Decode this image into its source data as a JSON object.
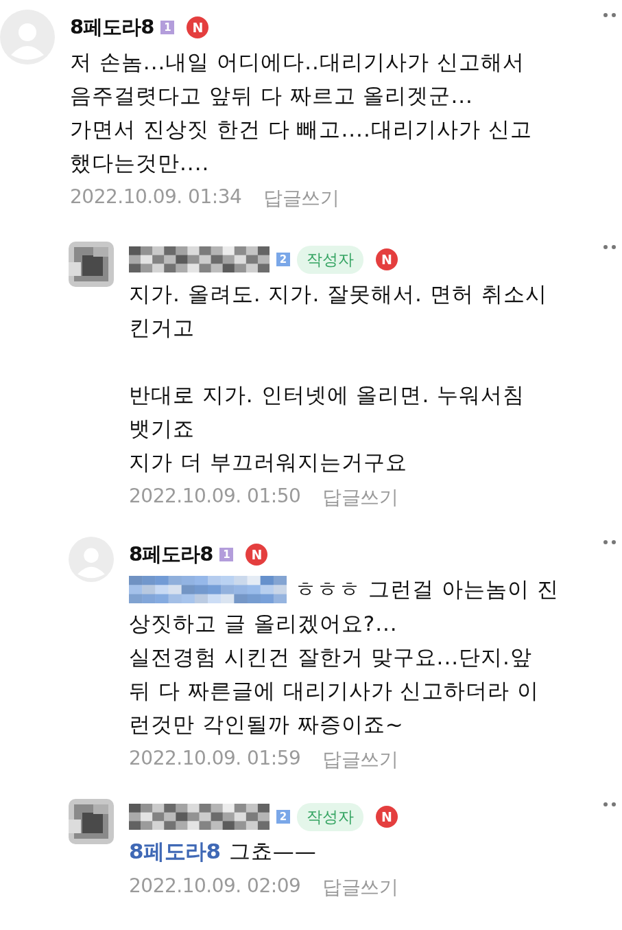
{
  "comments": [
    {
      "reply": false,
      "avatar": {
        "kind": "default"
      },
      "author": {
        "kind": "name",
        "text": "8페도라8"
      },
      "level": {
        "text": "1",
        "color": "#b39ddb"
      },
      "new_badge": "N",
      "paragraphs": [
        "저 손놈...내일 어디에다..대리기사가 신고해서\n음주걸렷다고 앞뒤 다 짜르고 올리겟군...\n가면서 진상짓 한건 다 빼고....대리기사가 신고\n했다는것만...."
      ],
      "date": "2022.10.09. 01:34",
      "reply_link": "답글쓰기"
    },
    {
      "reply": true,
      "avatar": {
        "kind": "blurred"
      },
      "author": {
        "kind": "blurred"
      },
      "level": {
        "text": "2",
        "color": "#7aa7e8"
      },
      "writer_badge": "작성자",
      "new_badge": "N",
      "paragraphs": [
        "지가. 올려도. 지가. 잘못해서. 면허 취소시\n킨거고",
        "반대로 지가. 인터넷에 올리면. 누워서침\n뱃기죠\n지가 더 부끄러워지는거구요"
      ],
      "date": "2022.10.09. 01:50",
      "reply_link": "답글쓰기"
    },
    {
      "reply": true,
      "avatar": {
        "kind": "default"
      },
      "author": {
        "kind": "name",
        "text": "8페도라8"
      },
      "level": {
        "text": "1",
        "color": "#b39ddb"
      },
      "new_badge": "N",
      "mention": {
        "kind": "blurred"
      },
      "mention_text": "ㅎㅎㅎ 그런걸 아는놈이 진",
      "paragraphs": [
        "상짓하고 글 올리겠어요?...\n실전경험 시킨건 잘한거 맞구요...단지.앞\n뒤 다 짜른글에 대리기사가 신고하더라 이\n런것만 각인될까 짜증이죠~"
      ],
      "date": "2022.10.09. 01:59",
      "reply_link": "답글쓰기"
    },
    {
      "reply": true,
      "avatar": {
        "kind": "blurred"
      },
      "author": {
        "kind": "blurred"
      },
      "level": {
        "text": "2",
        "color": "#7aa7e8"
      },
      "writer_badge": "작성자",
      "new_badge": "N",
      "mention": {
        "kind": "name",
        "text": "8페도라8"
      },
      "mention_text": "그쵸——",
      "date": "2022.10.09. 02:09",
      "reply_link": "답글쓰기"
    }
  ]
}
